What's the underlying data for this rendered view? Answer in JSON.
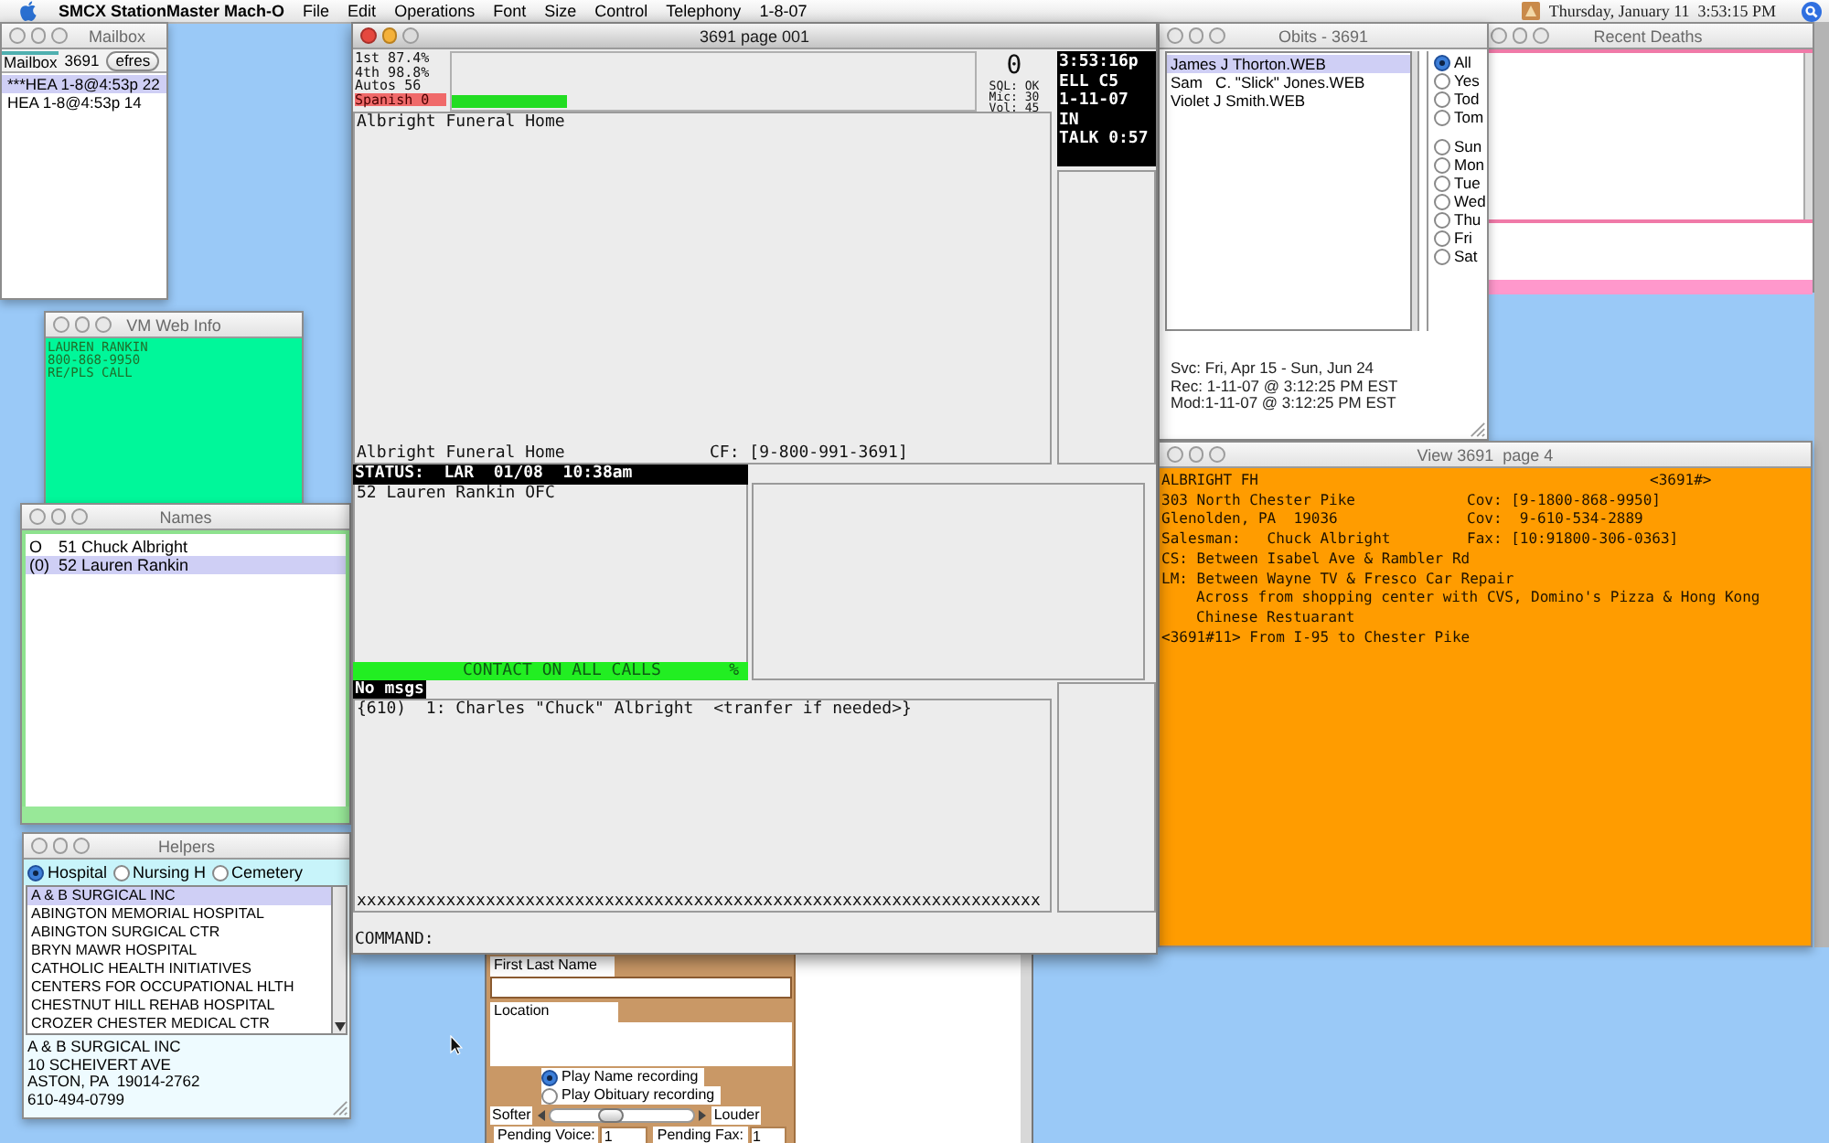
{
  "menu_bar": {
    "app_name": "SMCX StationMaster Mach-O",
    "menus": [
      "File",
      "Edit",
      "Operations",
      "Font",
      "Size",
      "Control",
      "Telephony",
      "1-8-07"
    ],
    "clock": "Thursday, January 11  3:53:15 PM"
  },
  "mailbox": {
    "title": "Mailbox",
    "active": false,
    "tab": "Mailbox",
    "number": "3691",
    "refresh_button": "efres",
    "items": [
      {
        "text": "***HEA 1-8@4:53p 22",
        "selected": true
      },
      {
        "text": "HEA 1-8@4:53p 14",
        "selected": false
      }
    ]
  },
  "vm_web_info": {
    "title": "VM Web Info",
    "active": false,
    "lines": [
      "LAUREN RANKIN",
      "800-868-9950",
      "RE/PLS CALL"
    ]
  },
  "names": {
    "title": "Names",
    "active": false,
    "items": [
      {
        "marker": "O",
        "text": "51 Chuck Albright",
        "selected": false
      },
      {
        "marker": "(0)",
        "text": "52 Lauren Rankin",
        "selected": true
      }
    ]
  },
  "helpers": {
    "title": "Helpers",
    "active": false,
    "categories": [
      {
        "label": "Hospital",
        "selected": true
      },
      {
        "label": "Nursing H",
        "selected": false
      },
      {
        "label": "Cemetery",
        "selected": false
      }
    ],
    "items": [
      {
        "text": "A & B SURGICAL INC",
        "selected": true
      },
      {
        "text": "ABINGTON MEMORIAL HOSPITAL",
        "selected": false
      },
      {
        "text": "ABINGTON SURGICAL CTR",
        "selected": false
      },
      {
        "text": "BRYN MAWR HOSPITAL",
        "selected": false
      },
      {
        "text": "CATHOLIC HEALTH INITIATIVES",
        "selected": false
      },
      {
        "text": "CENTERS FOR OCCUPATIONAL HLTH",
        "selected": false
      },
      {
        "text": "CHESTNUT HILL REHAB HOSPITAL",
        "selected": false
      },
      {
        "text": "CROZER CHESTER MEDICAL CTR",
        "selected": false
      }
    ],
    "address": [
      "A & B SURGICAL INC",
      "10 SCHEIVERT AVE",
      "ASTON, PA  19014-2762",
      "610-494-0799"
    ]
  },
  "main_window": {
    "title": "3691 page 001",
    "active": true,
    "stats": [
      "1st 87.4%",
      "4th 98.8%",
      "Autos 56"
    ],
    "alert": "Spanish 0",
    "meter": {
      "level": 0.22
    },
    "counter": "0",
    "system": [
      "SQL: OK",
      "Mic: 30",
      "Vol: 45"
    ],
    "call_info": [
      "3:53:16p",
      "ELL C5",
      "1-11-07",
      "IN",
      "TALK 0:57"
    ],
    "heading": "Albright Funeral Home",
    "footer_name": "Albright Funeral Home",
    "footer_cf": "CF: [9-800-991-3691]",
    "status": "STATUS:  LAR  01/08  10:38am",
    "status_lines": [
      "52 Lauren Rankin OFC"
    ],
    "banner": "CONTACT ON ALL CALLS",
    "banner_percent": "%",
    "messages": "No msgs",
    "contacts": [
      "{610)  1: Charles \"Chuck\" Albright  <tranfer if needed>}"
    ],
    "separator": "xxxxxxxxxxxxxxxxxxxxxxxxxxxxxxxxxxxxxxxxxxxxxxxxxxxxxxxxxxxxxxxxxxxxx",
    "command_label": "COMMAND:"
  },
  "recording_form": {
    "name_label": "First Last Name",
    "location_label": "Location",
    "options": [
      {
        "label": "Play Name recording",
        "selected": true
      },
      {
        "label": "Play Obituary recording",
        "selected": false
      }
    ],
    "softer": "Softer",
    "louder": "Louder",
    "volume": {
      "level": 0.4
    },
    "pending_voice_label": "Pending Voice:",
    "pending_voice": "1",
    "pending_fax_label": "Pending Fax:",
    "pending_fax": "1"
  },
  "obits": {
    "title": "Obits - 3691",
    "active": false,
    "items": [
      {
        "text": "James J Thorton.WEB",
        "selected": true
      },
      {
        "text": "Sam   C. \"Slick\" Jones.WEB",
        "selected": false
      },
      {
        "text": "Violet J Smith.WEB",
        "selected": false
      }
    ],
    "filters": [
      {
        "label": "All",
        "selected": true
      },
      {
        "label": "Yes",
        "selected": false
      },
      {
        "label": "Tod",
        "selected": false
      },
      {
        "label": "Tom",
        "selected": false
      }
    ],
    "days": [
      {
        "label": "Sun",
        "selected": false
      },
      {
        "label": "Mon",
        "selected": false
      },
      {
        "label": "Tue",
        "selected": false
      },
      {
        "label": "Wed",
        "selected": false
      },
      {
        "label": "Thu",
        "selected": false
      },
      {
        "label": "Fri",
        "selected": false
      },
      {
        "label": "Sat",
        "selected": false
      }
    ],
    "details": [
      "Svc: Fri, Apr 15 - Sun, Jun 24",
      "Rec: 1-11-07 @ 3:12:25 PM EST",
      "Mod:1-11-07 @ 3:12:25 PM EST"
    ]
  },
  "recent_deaths": {
    "title": "Recent Deaths",
    "active": false
  },
  "view": {
    "title": "View 3691  page 4",
    "active": false,
    "client_name": "ALBRIGHT FH",
    "client_code": "<3691#>",
    "rows": [
      {
        "text": "303 North Chester Pike",
        "phone": "Cov: [9-1800-868-9950]"
      },
      {
        "text": "Glenolden, PA  19036",
        "phone": "Cov:  9-610-534-2889"
      },
      {
        "text": "Salesman:   Chuck Albright",
        "phone": "Fax: [10:91800-306-0363]"
      }
    ],
    "notes": [
      {
        "kind": "line",
        "text": "CS: Between Isabel Ave & Rambler Rd"
      },
      {
        "kind": "line",
        "text": "LM: Between Wayne TV & Fresco Car Repair"
      },
      {
        "kind": "continuation",
        "text": "Across from shopping center with CVS, Domino's Pizza & Hong Kong"
      },
      {
        "kind": "continuation",
        "text": "Chinese Restuarant"
      },
      {
        "kind": "line",
        "text": "<3691#11> From I-95 to Chester Pike"
      }
    ]
  }
}
